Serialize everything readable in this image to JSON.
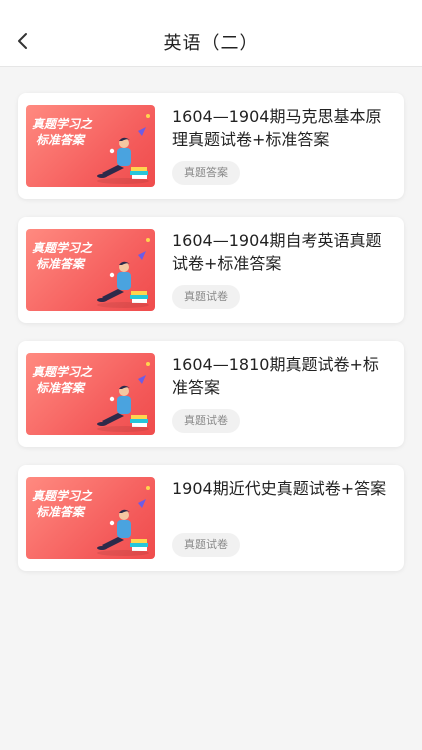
{
  "header": {
    "title": "英语（二）"
  },
  "thumbnail": {
    "line1": "真题学习之",
    "line2": "标准答案"
  },
  "items": [
    {
      "title": "1604—1904期马克思基本原理真题试卷+标准答案",
      "tag": "真题答案"
    },
    {
      "title": "1604—1904期自考英语真题试卷+标准答案",
      "tag": "真题试卷"
    },
    {
      "title": "1604—1810期真题试卷+标准答案",
      "tag": "真题试卷"
    },
    {
      "title": "1904期近代史真题试卷+答案",
      "tag": "真题试卷"
    }
  ],
  "colors": {
    "accent": "#f45a5a",
    "background": "#f5f5f5"
  }
}
